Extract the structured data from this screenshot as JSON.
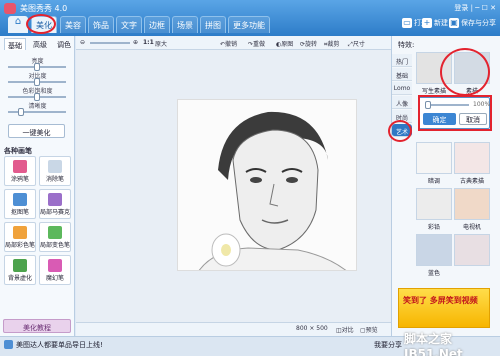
{
  "app": {
    "title": "美图秀秀 4.0"
  },
  "menu": {
    "items": [
      "美化",
      "美容",
      "饰品",
      "文字",
      "边框",
      "场景",
      "拼图",
      "更多功能"
    ],
    "active_index": 0
  },
  "top_actions": {
    "open": "打开",
    "new": "新建",
    "save": "保存与分享"
  },
  "window_controls": "登录 | ─ ☐ ✕",
  "left_panel": {
    "tabs": [
      "基础",
      "高级",
      "调色"
    ],
    "sliders": [
      {
        "label": "亮度",
        "value": 0.5
      },
      {
        "label": "对比度",
        "value": 0.5
      },
      {
        "label": "色彩饱和度",
        "value": 0.5
      },
      {
        "label": "清晰度",
        "value": 0.2
      }
    ],
    "one_click": "一键美化",
    "brush_header": "各种画笔",
    "tools": [
      "涂鸦笔",
      "消除笔",
      "抠图笔",
      "局部马赛克",
      "局部彩色笔",
      "局部变色笔",
      "背景虚化",
      "魔幻笔"
    ],
    "tutorial": "美化教程"
  },
  "canvas_toolbar": {
    "zoom": "1:1",
    "original_size": "原大",
    "rotate": "旋转",
    "undo": "撤销",
    "redo": "重做",
    "compare": "原图",
    "crop": "裁剪",
    "size": "尺寸"
  },
  "canvas_status": {
    "dimensions": "800 × 500",
    "compare": "对比",
    "preview": "预览"
  },
  "right_panel": {
    "title": "特效:",
    "categories": [
      "热门",
      "基础",
      "Lomo",
      "人像",
      "时尚",
      "艺术"
    ],
    "active_category": "艺术",
    "effects": [
      "写生素描",
      "素描",
      "暗调",
      "古典素描",
      "彩铅",
      "电视机",
      "蓝色"
    ],
    "selected_effect": "素描",
    "popup": {
      "percent": "100%",
      "ok": "确定",
      "cancel": "取消"
    }
  },
  "ad": {
    "text": "笑到了 多屏笑到视频"
  },
  "status": {
    "text": "美图达人都要单品导日上线!",
    "share": "我要分享"
  },
  "watermark": "脚本之家 JB51.Net",
  "colors": {
    "primary": "#2d7cc8",
    "highlight": "#e3232e",
    "panel": "#f3f7fb"
  }
}
